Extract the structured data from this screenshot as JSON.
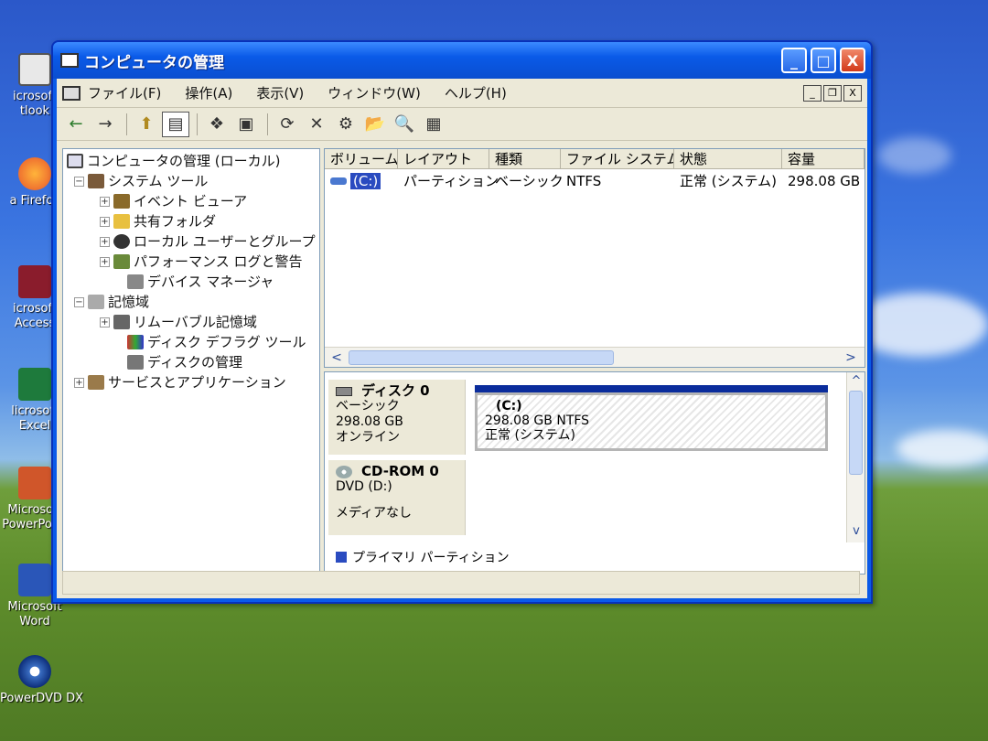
{
  "desktop": {
    "icons": [
      {
        "label1": "icrosoft",
        "label2": "tlook",
        "icon": "outlook-icon"
      },
      {
        "label1": "a Firefox",
        "label2": "",
        "icon": "firefox-icon"
      },
      {
        "label1": "icrosoft",
        "label2": "Access",
        "icon": "access-icon"
      },
      {
        "label1": "licrosoft",
        "label2": "Excel",
        "icon": "excel-icon"
      },
      {
        "label1": "Microsoft",
        "label2": "PowerPoint",
        "icon": "powerpoint-icon"
      },
      {
        "label1": "Microsoft",
        "label2": "Word",
        "icon": "word-icon"
      },
      {
        "label1": "PowerDVD DX",
        "label2": "",
        "icon": "powerdvd-icon"
      }
    ]
  },
  "window": {
    "title": "コンピュータの管理",
    "controls": {
      "minimize": "_",
      "maximize": "□",
      "close": "X"
    }
  },
  "menubar": {
    "items": [
      "ファイル(F)",
      "操作(A)",
      "表示(V)",
      "ウィンドウ(W)",
      "ヘルプ(H)"
    ],
    "mdi": {
      "minimize": "_",
      "restore": "❐",
      "close": "X"
    }
  },
  "toolbar": {
    "back": "←",
    "forward": "→",
    "up": "⬆",
    "tree": "▤",
    "properties": "❖",
    "view": "▣",
    "refresh": "⟳",
    "delete": "✕",
    "settings": "⚙",
    "open": "📂",
    "search": "🔍",
    "export": "▦"
  },
  "tree": {
    "items": [
      {
        "label": "コンピュータの管理 (ローカル)",
        "exp": ""
      },
      {
        "label": "システム ツール",
        "exp": "−"
      },
      {
        "label": "イベント ビューア",
        "exp": "+"
      },
      {
        "label": "共有フォルダ",
        "exp": "+"
      },
      {
        "label": "ローカル ユーザーとグループ",
        "exp": "+"
      },
      {
        "label": "パフォーマンス ログと警告",
        "exp": "+"
      },
      {
        "label": "デバイス マネージャ",
        "exp": ""
      },
      {
        "label": "記憶域",
        "exp": "−"
      },
      {
        "label": "リムーバブル記憶域",
        "exp": "+"
      },
      {
        "label": "ディスク デフラグ ツール",
        "exp": ""
      },
      {
        "label": "ディスクの管理",
        "exp": ""
      },
      {
        "label": "サービスとアプリケーション",
        "exp": "+"
      }
    ]
  },
  "volumes": {
    "columns": [
      "ボリューム",
      "レイアウト",
      "種類",
      "ファイル システム",
      "状態",
      "容量"
    ],
    "rows": [
      {
        "volume": "(C:)",
        "layout": "パーティション",
        "type": "ベーシック",
        "fs": "NTFS",
        "status": "正常 (システム)",
        "capacity": "298.08 GB"
      }
    ]
  },
  "scroll": {
    "left": "<",
    "right": ">",
    "up": "^",
    "down": "v"
  },
  "disks": {
    "disk0": {
      "name": "ディスク 0",
      "type": "ベーシック",
      "size": "298.08 GB",
      "status": "オンライン",
      "volume": {
        "name": "(C:)",
        "detail": "298.08 GB NTFS",
        "status": "正常 (システム)"
      }
    },
    "cdrom0": {
      "name": "CD-ROM 0",
      "type": "DVD (D:)",
      "media": "メディアなし"
    }
  },
  "legend": {
    "primary": "プライマリ パーティション"
  }
}
